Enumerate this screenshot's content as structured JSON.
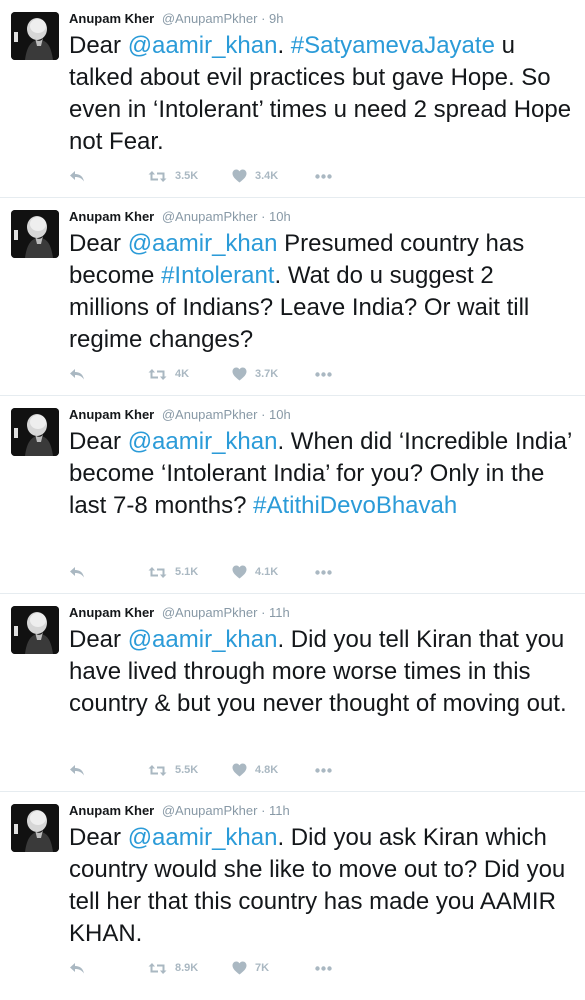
{
  "colors": {
    "link": "#2b9bd8",
    "muted": "#8899a6",
    "action": "#aab8c2"
  },
  "tweets": [
    {
      "name": "Anupam Kher",
      "handle": "@AnupamPkher",
      "time": "9h",
      "parts": [
        {
          "text": "Dear "
        },
        {
          "text": "@aamir_khan",
          "link": true
        },
        {
          "text": ". "
        },
        {
          "text": "#SatyamevaJayate",
          "link": true
        },
        {
          "text": " u talked about evil practices but gave Hope. So even in ‘Intolerant’ times u need 2 spread Hope not Fear."
        }
      ],
      "retweets": "3.5K",
      "likes": "3.4K"
    },
    {
      "name": "Anupam Kher",
      "handle": "@AnupamPkher",
      "time": "10h",
      "parts": [
        {
          "text": "Dear "
        },
        {
          "text": "@aamir_khan",
          "link": true
        },
        {
          "text": " Presumed country has become "
        },
        {
          "text": "#Intolerant",
          "link": true
        },
        {
          "text": ". Wat do u suggest 2 millions of Indians? Leave India? Or wait till regime changes?"
        }
      ],
      "retweets": "4K",
      "likes": "3.7K"
    },
    {
      "name": "Anupam Kher",
      "handle": "@AnupamPkher",
      "time": "10h",
      "parts": [
        {
          "text": "Dear "
        },
        {
          "text": "@aamir_khan",
          "link": true
        },
        {
          "text": ". When did ‘Incredible India’ become ‘Intolerant India’ for you? Only in the last 7-8 months? "
        },
        {
          "text": "#AtithiDevoBhavah",
          "link": true
        }
      ],
      "retweets": "5.1K",
      "likes": "4.1K"
    },
    {
      "name": "Anupam Kher",
      "handle": "@AnupamPkher",
      "time": "11h",
      "parts": [
        {
          "text": "Dear "
        },
        {
          "text": "@aamir_khan",
          "link": true
        },
        {
          "text": ". Did you tell Kiran that you have lived through more worse times in this country & but you never thought of moving out."
        }
      ],
      "retweets": "5.5K",
      "likes": "4.8K"
    },
    {
      "name": "Anupam Kher",
      "handle": "@AnupamPkher",
      "time": "11h",
      "parts": [
        {
          "text": "Dear "
        },
        {
          "text": "@aamir_khan",
          "link": true
        },
        {
          "text": ". Did you ask Kiran which country would she like to move out to? Did you tell her that this country has made you AAMIR KHAN."
        }
      ],
      "retweets": "8.9K",
      "likes": "7K"
    }
  ]
}
